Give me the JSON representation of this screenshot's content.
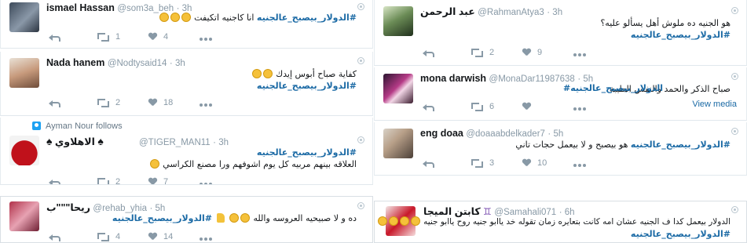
{
  "left": {
    "tweets": [
      {
        "name": "ismael Hassan",
        "handle": "@som3a_beh",
        "time": "3h",
        "text_hash": "#الدولار_بيصبح_عالجنيه",
        "text": " انا كاجنيه اتكيفت",
        "emojis": 3,
        "reply_count": "",
        "retweet_count": "1",
        "like_count": "4"
      },
      {
        "name": "Nada hanem",
        "handle": "@Nodtysaid14",
        "time": "3h",
        "line1": "كفاية صباح أبوس إيدك",
        "line1_emojis": 2,
        "hash": "#الدولار_بيصبح_عالجنيه",
        "retweet_count": "2",
        "like_count": "18"
      },
      {
        "follows_label": "Ayman Nour follows",
        "name": "الاهلاوي",
        "handle": "@TIGER_MAN11",
        "time": "3h",
        "hash": "#الدولار_بيصبح_عالجنيه",
        "line2": "العلاقه بينهم مربيه كل يوم اشوفهم ورا مصنع الكراسي",
        "line2_emojis": 1,
        "retweet_count": "2",
        "like_count": "7"
      },
      {
        "name": "ريحا\"\"\"ب",
        "handle": "@rehab_yhia",
        "time": "5h",
        "text_hash": "#الدولار_بيصبح_عالجنيه",
        "text": "ده و لا صبيحيه العروسه والله",
        "emojis": 2,
        "retweet_count": "4",
        "like_count": "14"
      }
    ]
  },
  "right": {
    "tweets": [
      {
        "name": "عبد الرحمن",
        "handle": "@RahmanAtya3",
        "time": "3h",
        "line1": "هو الجنيه ده ملوش أهل يسألو عليه؟",
        "hash": "#الدولار_بيصبح_عالجنيه",
        "retweet_count": "2",
        "like_count": "9"
      },
      {
        "name": "mona darwish",
        "handle": "@MonaDar11987638",
        "time": "5h",
        "line1": "صباح الذكر والحمد والنفس الطيبة",
        "hash": "#الدولار_بيصبح_عالجنيه",
        "view_media": "View media",
        "retweet_count": "6",
        "like_count": ""
      },
      {
        "name": "eng doaa",
        "handle": "@doaaabdelkader7",
        "time": "5h",
        "text_hash": "#الدولار_بيصبح_عالجنيه",
        "text": " هو بيصبح و لا بيعمل حجات تاني",
        "retweet_count": "3",
        "like_count": "10"
      },
      {
        "name": "كابتن الميجا",
        "handle": "@Samahali071",
        "time": "6h",
        "line1": "الدولار بيعمل كدا ف الجنيه عشان امه كانت بتعايره زمان تقوله خد ياابو جنيه روح ياابو جنيه",
        "line1_emojis": 4,
        "hash": "#الدولار_بيصبح_عالجنيه"
      }
    ]
  },
  "colors": {
    "hashtag": "#1b6aa5",
    "muted": "#8899a6",
    "text": "#14171a",
    "border": "#e1e8ed"
  }
}
